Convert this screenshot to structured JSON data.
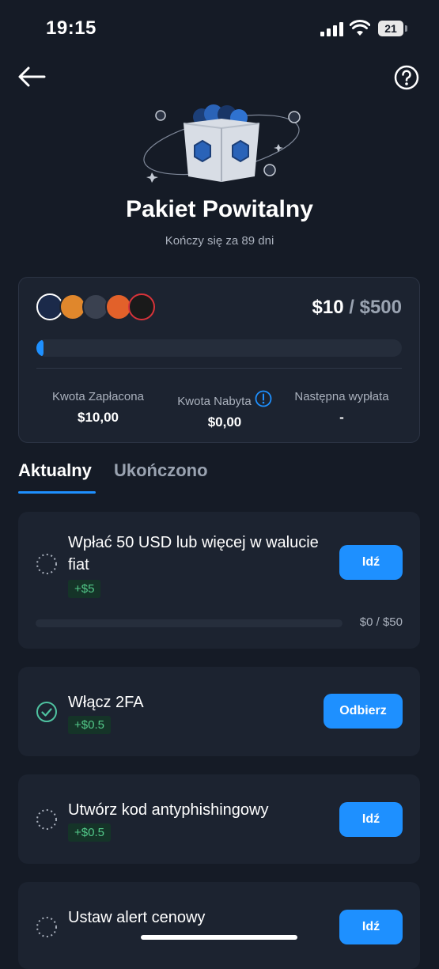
{
  "status_bar": {
    "time": "19:15",
    "battery": "21"
  },
  "header": {
    "title": "Pakiet Powitalny",
    "subtitle": "Kończy się za 89 dni"
  },
  "summary": {
    "amount_current": "$10",
    "amount_separator": " / ",
    "amount_total": "$500",
    "progress_fraction": 0.02,
    "stats": [
      {
        "label": "Kwota Zapłacona",
        "value": "$10,00"
      },
      {
        "label": "Kwota Nabyta",
        "value": "$0,00"
      },
      {
        "label": "Następna wypłata",
        "value": "-"
      }
    ]
  },
  "tabs": [
    {
      "label": "Aktualny",
      "active": true
    },
    {
      "label": "Ukończono",
      "active": false
    }
  ],
  "tasks": [
    {
      "title_line1": "Wpłać 50 USD lub więcej w walucie",
      "title_line2": "fiat",
      "reward": "+$5",
      "button": "Idź",
      "progress_label": "$0 / $50",
      "progress_fraction": 0.0,
      "done": false
    },
    {
      "title_line1": "Włącz 2FA",
      "reward": "+$0.5",
      "button": "Odbierz",
      "done": true
    },
    {
      "title_line1": "Utwórz kod antyphishingowy",
      "reward": "+$0.5",
      "button": "Idź",
      "done": false
    },
    {
      "title_line1": "Ustaw alert cenowy",
      "button": "Idź",
      "done": false
    }
  ],
  "colors": {
    "accent": "#1e90ff",
    "background": "#151b26",
    "card": "#1c2330",
    "reward_text": "#53c98a",
    "reward_bg": "#153428"
  },
  "icons": [
    "back-arrow-icon",
    "help-icon",
    "gift-box-icon",
    "info-icon",
    "pending-status-icon",
    "check-status-icon"
  ]
}
